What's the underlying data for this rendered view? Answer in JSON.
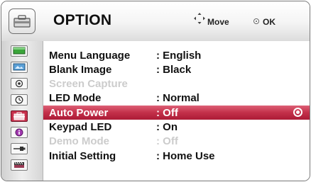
{
  "header": {
    "title": "OPTION",
    "icon": "option-toolbox-icon",
    "move_label": "Move",
    "ok_label": "OK"
  },
  "sidebar": {
    "items": [
      {
        "icon": "picture-icon",
        "active": false
      },
      {
        "icon": "screen-icon",
        "active": false
      },
      {
        "icon": "sound-icon",
        "active": false
      },
      {
        "icon": "time-icon",
        "active": false
      },
      {
        "icon": "option-icon",
        "active": true
      },
      {
        "icon": "info-icon",
        "active": false
      },
      {
        "icon": "input-icon",
        "active": false
      },
      {
        "icon": "media-icon",
        "active": false
      }
    ]
  },
  "menu": {
    "rows": [
      {
        "label": "Menu Language",
        "value": ": English",
        "state": "normal"
      },
      {
        "label": "Blank Image",
        "value": ": Black",
        "state": "normal"
      },
      {
        "label": "Screen Capture",
        "value": "",
        "state": "disabled"
      },
      {
        "label": "LED Mode",
        "value": ": Normal",
        "state": "normal"
      },
      {
        "label": "Auto Power",
        "value": ": Off",
        "state": "selected"
      },
      {
        "label": "Keypad LED",
        "value": ": On",
        "state": "normal"
      },
      {
        "label": "Demo Mode",
        "value": ": Off",
        "state": "disabled"
      },
      {
        "label": "Initial Setting",
        "value": ": Home Use",
        "state": "normal"
      }
    ]
  },
  "colors": {
    "selection": "#c3304a",
    "disabled_text": "#cccccc",
    "text": "#111111"
  }
}
